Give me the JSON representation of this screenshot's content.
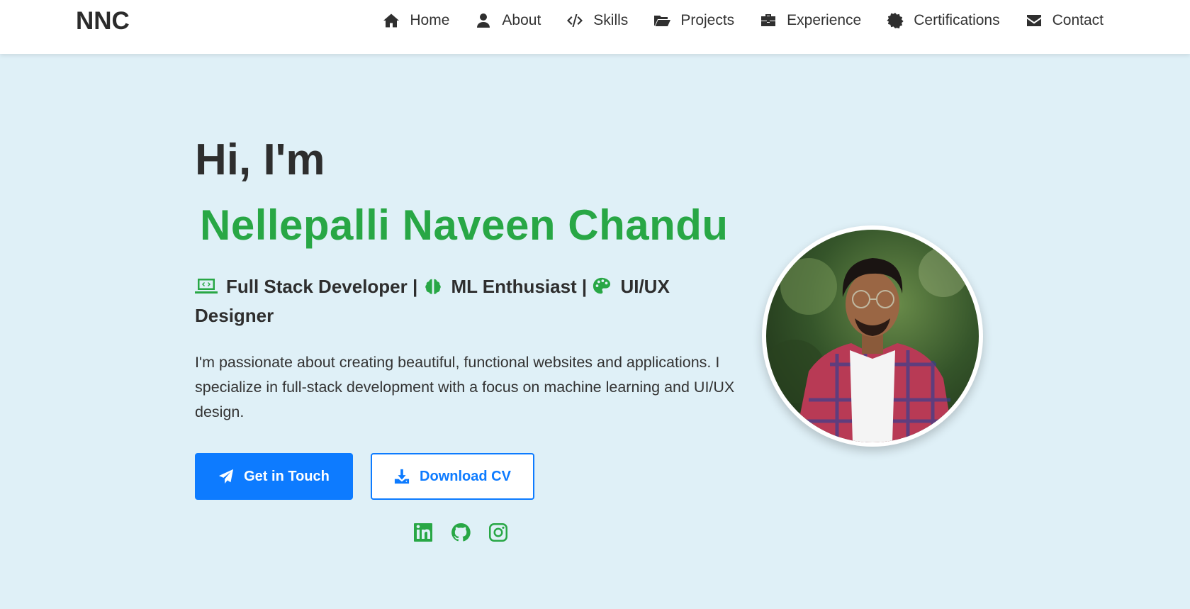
{
  "brand": "NNC",
  "nav": [
    {
      "label": "Home",
      "icon": "home-icon"
    },
    {
      "label": "About",
      "icon": "user-icon"
    },
    {
      "label": "Skills",
      "icon": "code-icon"
    },
    {
      "label": "Projects",
      "icon": "folder-open-icon"
    },
    {
      "label": "Experience",
      "icon": "briefcase-icon"
    },
    {
      "label": "Certifications",
      "icon": "certificate-icon"
    },
    {
      "label": "Contact",
      "icon": "envelope-icon"
    }
  ],
  "hero": {
    "greeting": "Hi, I'm",
    "name": "Nellepalli Naveen Chandu",
    "roles": [
      {
        "label": "Full Stack Developer |",
        "icon": "laptop-code-icon"
      },
      {
        "label": "ML Enthusiast |",
        "icon": "brain-icon"
      },
      {
        "label": "UI/UX Designer",
        "icon": "palette-icon"
      }
    ],
    "description": "I'm passionate about creating beautiful, functional websites and applications. I specialize in full-stack development with a focus on machine learning and UI/UX design."
  },
  "buttons": {
    "primary": {
      "label": "Get in Touch",
      "icon": "paper-plane-icon"
    },
    "secondary": {
      "label": "Download CV",
      "icon": "download-icon"
    }
  },
  "social": [
    "linkedin-icon",
    "github-icon",
    "instagram-icon"
  ],
  "colors": {
    "accent": "#28a745",
    "primary": "#0d7bff",
    "background": "#dff0f7",
    "navbar": "#ffffff"
  }
}
